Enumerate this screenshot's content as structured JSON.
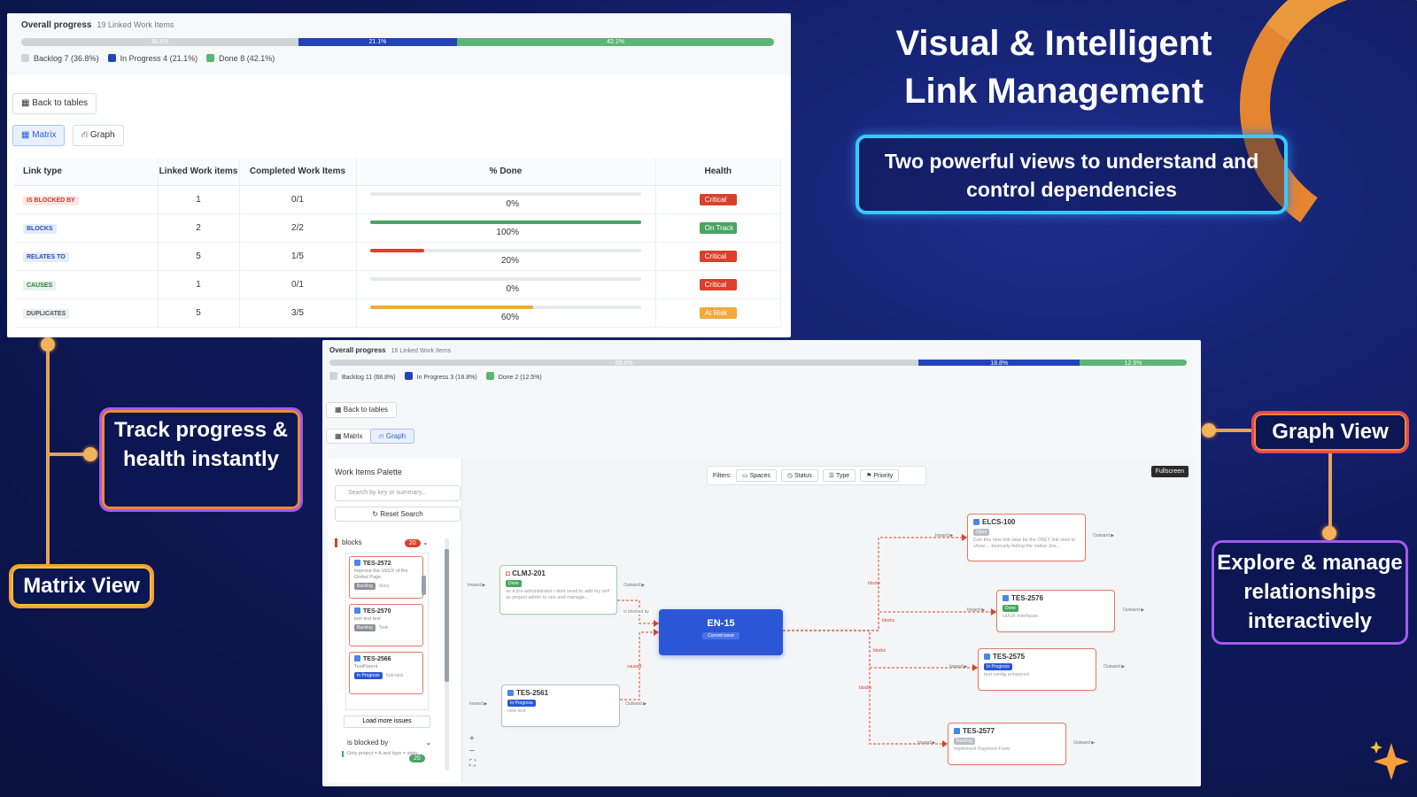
{
  "hero": {
    "title_line1": "Visual & Intelligent",
    "title_line2": "Link Management",
    "subtitle": "Two powerful views to understand and control  dependencies"
  },
  "callouts": {
    "track": "Track progress & health instantly",
    "matrix": "Matrix View",
    "graph": "Graph View",
    "explore": "Explore & manage relationships interactively"
  },
  "colors": {
    "backlog": "#d0d3d8",
    "in_progress": "#2244b8",
    "done": "#5cb475",
    "critical": "#d9412c",
    "on_track": "#48a463",
    "at_risk": "#f2a93b"
  },
  "matrix_panel": {
    "overall_title": "Overall progress",
    "overall_sub": "19 Linked Work Items",
    "segments": [
      {
        "label": "36.8%",
        "value": 36.8,
        "color": "#d0d3d8"
      },
      {
        "label": "21.1%",
        "value": 21.1,
        "color": "#2244b8"
      },
      {
        "label": "42.1%",
        "value": 42.1,
        "color": "#5cb475"
      }
    ],
    "legend": [
      {
        "label": "Backlog",
        "count": "7 (36.8%)"
      },
      {
        "label": "In Progress",
        "count": "4 (21.1%)"
      },
      {
        "label": "Done",
        "count": "8 (42.1%)"
      }
    ],
    "back_button": "Back to tables",
    "tab_matrix": "Matrix",
    "tab_graph": "Graph",
    "columns": [
      "Link type",
      "Linked Work items",
      "Completed Work Items",
      "% Done",
      "Health"
    ],
    "rows": [
      {
        "type": "IS BLOCKED BY",
        "type_fg": "#c5392b",
        "type_bg": "#fde7e4",
        "linked": "1",
        "completed": "0/1",
        "pct": 0,
        "pct_label": "0%",
        "bar": "#d9412c",
        "health": "Critical",
        "health_color": "#d9412c"
      },
      {
        "type": "BLOCKS",
        "type_fg": "#2c4fb3",
        "type_bg": "#e4ebfb",
        "linked": "2",
        "completed": "2/2",
        "pct": 100,
        "pct_label": "100%",
        "bar": "#48a463",
        "health": "On Track",
        "health_color": "#48a463"
      },
      {
        "type": "RELATES TO",
        "type_fg": "#2c4fb3",
        "type_bg": "#e4ebfb",
        "linked": "5",
        "completed": "1/5",
        "pct": 20,
        "pct_label": "20%",
        "bar": "#d9412c",
        "health": "Critical",
        "health_color": "#d9412c"
      },
      {
        "type": "CAUSES",
        "type_fg": "#2d7a40",
        "type_bg": "#e4f4e8",
        "linked": "1",
        "completed": "0/1",
        "pct": 0,
        "pct_label": "0%",
        "bar": "#d9412c",
        "health": "Critical",
        "health_color": "#d9412c"
      },
      {
        "type": "DUPLICATES",
        "type_fg": "#555",
        "type_bg": "#eceef1",
        "linked": "5",
        "completed": "3/5",
        "pct": 60,
        "pct_label": "60%",
        "bar": "#f2a93b",
        "health": "At Risk",
        "health_color": "#f2a93b"
      }
    ]
  },
  "graph_panel": {
    "overall_title": "Overall progress",
    "overall_sub": "16 Linked Work Items",
    "segments": [
      {
        "label": "68.8%",
        "value": 68.8,
        "color": "#d0d3d8"
      },
      {
        "label": "18.8%",
        "value": 18.8,
        "color": "#2244b8"
      },
      {
        "label": "12.5%",
        "value": 12.5,
        "color": "#5cb475"
      }
    ],
    "legend": [
      {
        "label": "Backlog",
        "count": "11 (68.8%)"
      },
      {
        "label": "In Progress",
        "count": "3 (18.8%)"
      },
      {
        "label": "Done",
        "count": "2 (12.5%)"
      }
    ],
    "back_button": "Back to tables",
    "tab_matrix": "Matrix",
    "tab_graph": "Graph",
    "palette_title": "Work Items Palette",
    "search_placeholder": "Search by key or summary...",
    "reset_label": "Reset Search",
    "group1_label": "blocks",
    "group1_count": "20",
    "group2_label": "is blocked by",
    "group2_count": "20",
    "group2_desc": "Only project = A and type = story",
    "load_more": "Load more issues",
    "palette_cards": [
      {
        "key": "TES-2572",
        "desc": "Improve the UI/UX of the Global Page",
        "tag": "Backlog",
        "tag2": "Story"
      },
      {
        "key": "TES-2570",
        "desc": "test test test",
        "tag": "Backlog",
        "tag2": "Task"
      },
      {
        "key": "TES-2566",
        "desc": "TestParent",
        "tag": "In Progress",
        "tag2": "Sub-task"
      }
    ],
    "filters_label": "Filters:",
    "filters": [
      "Spaces",
      "Status",
      "Type",
      "Priority"
    ],
    "fullscreen": "Fullscreen",
    "center": {
      "key": "EN-15",
      "tag": "Current issue"
    },
    "inward": "Inward ▶",
    "outward": "Outward ▶",
    "nodes": {
      "clmj": {
        "key": "CLMJ-201",
        "tag": "Done",
        "desc": "as a jira administrator i dont need to add my self as project admin to see and manage..."
      },
      "tes2561": {
        "key": "TES-2561",
        "tag": "In Progress",
        "desc": "new test"
      },
      "elcs": {
        "key": "ELCS-100",
        "tag": "Open",
        "desc": "Can this new link view be the ONLY link view to show ... basically hiding the native Jira..."
      },
      "tes2576": {
        "key": "TES-2576",
        "tag": "Done",
        "desc": "UI/UX interfaces"
      },
      "tes2575": {
        "key": "TES-2575",
        "tag": "In Progress",
        "desc": "test config enhanced"
      },
      "tes2577": {
        "key": "TES-2577",
        "tag": "Backlog",
        "desc": "Implement Payment Form"
      }
    },
    "edge_labels": {
      "is_blocked_by": "is blocked by",
      "caused": "caused",
      "blocks": "blocks"
    }
  }
}
